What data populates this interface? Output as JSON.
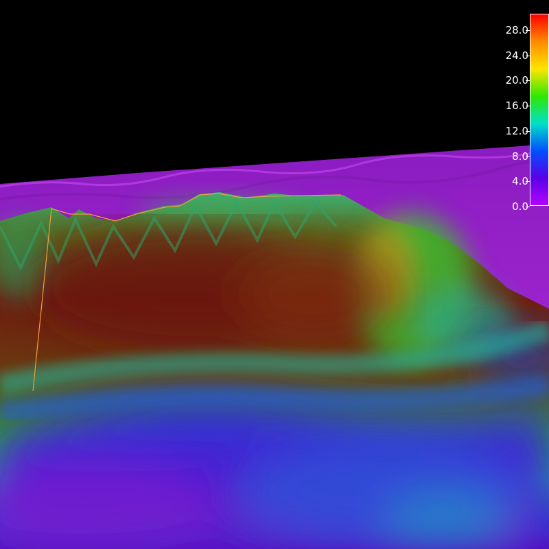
{
  "colorbar": {
    "ticks": [
      "28.0",
      "24.0",
      "20.0",
      "16.0",
      "12.0",
      "8.0",
      "4.0",
      "0.0"
    ],
    "gradient": [
      "#ff0000",
      "#ff8a00",
      "#ffe600",
      "#2ee800",
      "#00e0c8",
      "#0050ff",
      "#5a00e8",
      "#b400ff"
    ]
  },
  "scene_colors": {
    "sky": "#000000",
    "plain": "#a020d8",
    "high": "#7a1a10",
    "mid": "#3fa040",
    "low": "#1f3ad0"
  }
}
